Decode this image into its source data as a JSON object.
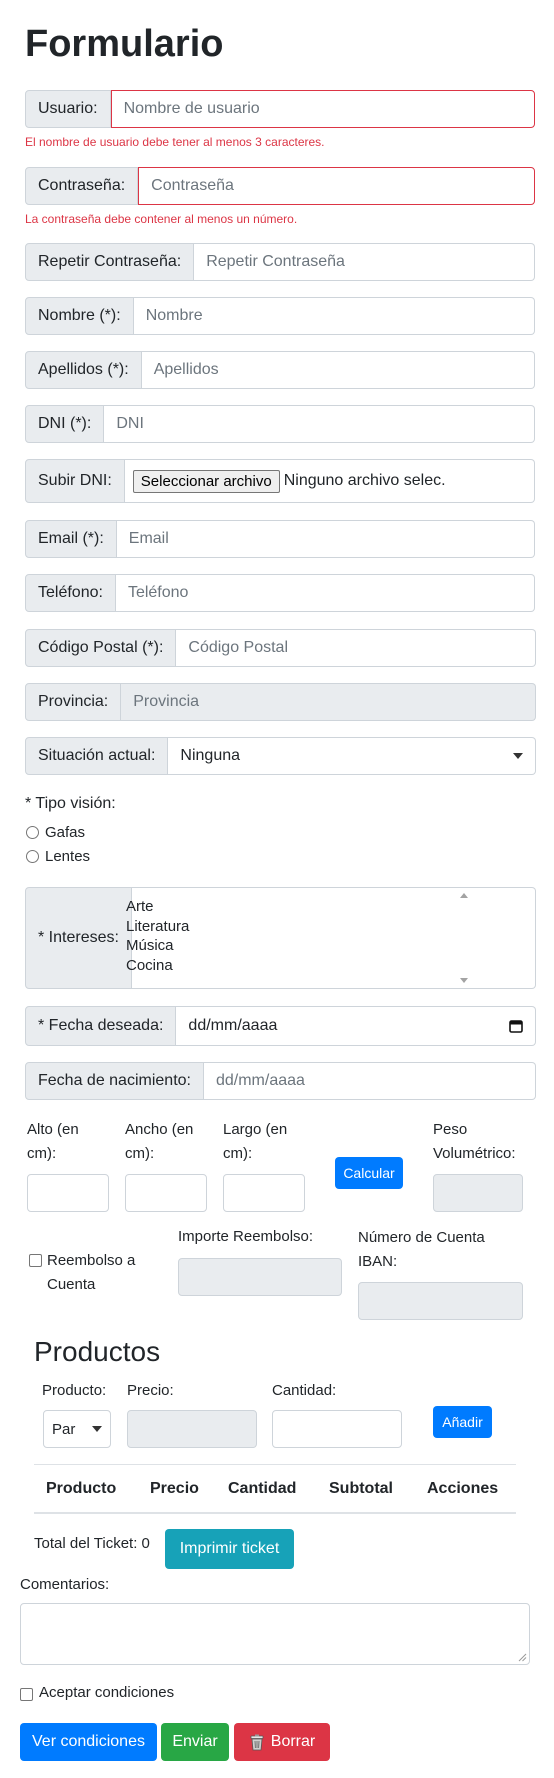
{
  "title": "Formulario",
  "usuario": {
    "label": "Usuario:",
    "placeholder": "Nombre de usuario",
    "error": "El nombre de usuario debe tener al menos 3 caracteres."
  },
  "contrasena": {
    "label": "Contraseña:",
    "placeholder": "Contraseña",
    "error": "La contraseña debe contener al menos un número."
  },
  "repetir": {
    "label": "Repetir Contraseña:",
    "placeholder": "Repetir Contraseña"
  },
  "nombre": {
    "label": "Nombre (*):",
    "placeholder": "Nombre"
  },
  "apellidos": {
    "label": "Apellidos (*):",
    "placeholder": "Apellidos"
  },
  "dni": {
    "label": "DNI (*):",
    "placeholder": "DNI"
  },
  "subir_dni": {
    "label": "Subir DNI:",
    "button": "Seleccionar archivo",
    "status": "Ninguno archivo selec."
  },
  "email": {
    "label": "Email (*):",
    "placeholder": "Email"
  },
  "telefono": {
    "label": "Teléfono:",
    "placeholder": "Teléfono"
  },
  "codigo_postal": {
    "label": "Código Postal (*):",
    "placeholder": "Código Postal"
  },
  "provincia": {
    "label": "Provincia:",
    "placeholder": "Provincia"
  },
  "situacion": {
    "label": "Situación actual:",
    "value": "Ninguna"
  },
  "tipo_vision": {
    "label": "* Tipo visión:",
    "options": [
      "Gafas",
      "Lentes"
    ]
  },
  "intereses": {
    "label": "* Intereses:",
    "options": [
      "Arte",
      "Literatura",
      "Música",
      "Cocina"
    ]
  },
  "fecha_deseada": {
    "label": "* Fecha deseada:",
    "placeholder": "dd/mm/aaaa"
  },
  "fecha_nacimiento": {
    "label": "Fecha de nacimiento:",
    "placeholder": "dd/mm/aaaa"
  },
  "medidas": {
    "alto": [
      "Alto (en",
      "cm):"
    ],
    "ancho": [
      "Ancho (en",
      "cm):"
    ],
    "largo": [
      "Largo (en",
      "cm):"
    ],
    "calcular": "Calcular",
    "peso": [
      "Peso",
      "Volumétrico:"
    ]
  },
  "reembolso": {
    "checkbox": [
      "Reembolso a",
      "Cuenta"
    ],
    "importe": "Importe Reembolso:",
    "iban": [
      "Número de Cuenta",
      "IBAN:"
    ]
  },
  "productos": {
    "title": "Productos",
    "producto_label": "Producto:",
    "producto_value": "Par",
    "precio_label": "Precio:",
    "cantidad_label": "Cantidad:",
    "anadir": "Añadir",
    "columns": [
      "Producto",
      "Precio",
      "Cantidad",
      "Subtotal",
      "Acciones"
    ],
    "total": "Total del Ticket: 0",
    "imprimir": "Imprimir ticket"
  },
  "comentarios": "Comentarios:",
  "aceptar": "Aceptar condiciones",
  "buttons": {
    "ver": "Ver condiciones",
    "enviar": "Enviar",
    "borrar": "Borrar"
  },
  "colors": {
    "primary": "#007bff",
    "info": "#17a2b8",
    "success": "#28a745",
    "danger": "#dc3545"
  }
}
